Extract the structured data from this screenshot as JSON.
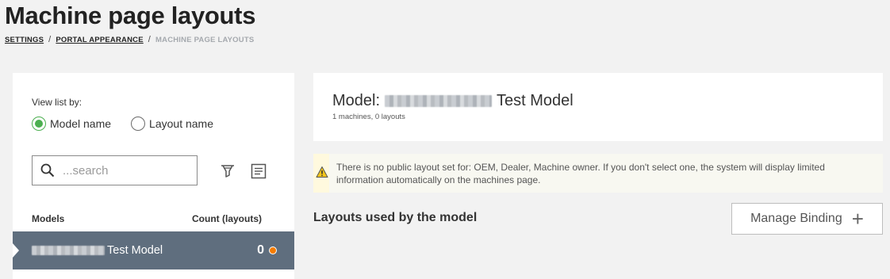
{
  "header": {
    "title": "Machine page layouts",
    "breadcrumb": {
      "settings": "SETTINGS",
      "portal_appearance": "PORTAL APPEARANCE",
      "current": "MACHINE PAGE LAYOUTS",
      "separator": "/"
    }
  },
  "sidebar": {
    "view_label": "View list by:",
    "radios": [
      {
        "label": "Model name",
        "checked": true
      },
      {
        "label": "Layout name",
        "checked": false
      }
    ],
    "search": {
      "placeholder": "...search",
      "value": ""
    },
    "icons": [
      "filter-icon",
      "list-icon"
    ],
    "list": {
      "col_models": "Models",
      "col_count": "Count (layouts)",
      "rows": [
        {
          "name": "Test Model",
          "count": "0",
          "status_color": "#f57c00"
        }
      ]
    }
  },
  "model_card": {
    "prefix": "Model:",
    "name": "Test Model",
    "meta": "1 machines, 0 layouts"
  },
  "warning": {
    "text": "There is no public layout set for: OEM, Dealer, Machine owner. If you don't select one, the system will display limited information automatically on the machines page.",
    "color": "#f5c518"
  },
  "layouts": {
    "title": "Layouts used by the model",
    "manage_label": "Manage Binding",
    "manage_icon": "plus-icon"
  },
  "colors": {
    "accent_green": "#4caf50",
    "selected_row": "#5f6e7e"
  }
}
